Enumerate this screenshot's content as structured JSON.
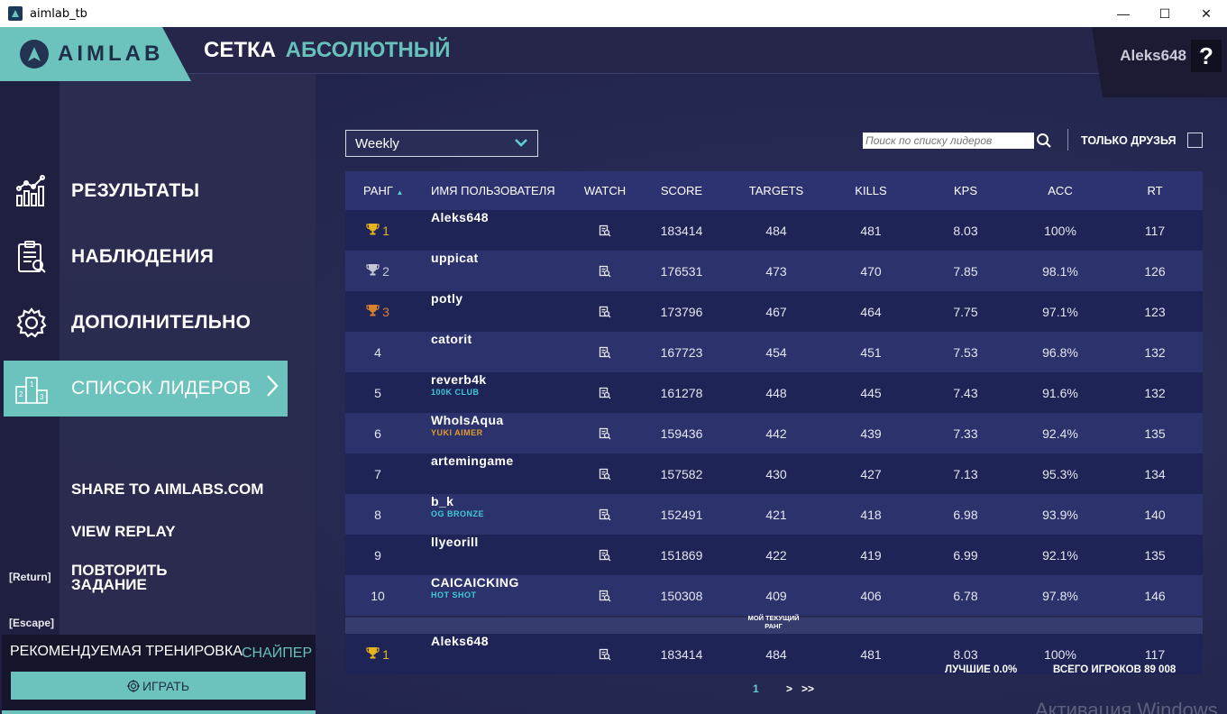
{
  "window": {
    "title": "aimlab_tb",
    "minimize": "—",
    "maximize": "☐",
    "close": "✕"
  },
  "header": {
    "logo_text": "AIMLAB",
    "title": "СЕТКА",
    "subtitle": "АБСОЛЮТНЫЙ",
    "username": "Aleks648",
    "help": "?"
  },
  "nav": [
    {
      "label": "РЕЗУЛЬТАТЫ",
      "icon": "chart-icon"
    },
    {
      "label": "НАБЛЮДЕНИЯ",
      "icon": "clipboard-icon"
    },
    {
      "label": "ДОПОЛНИТЕЛЬНО",
      "icon": "gear-icon"
    },
    {
      "label": "СПИСОК ЛИДЕРОВ",
      "icon": "podium-icon",
      "active": true
    }
  ],
  "actions": {
    "share": "SHARE TO AIMLABS.COM",
    "replay": "VIEW REPLAY",
    "repeat_line1": "ПОВТОРИТЬ",
    "repeat_line2": "ЗАДАНИЕ",
    "return_key": "[Return]",
    "escape_key": "[Escape]"
  },
  "recommended": {
    "title": "РЕКОМЕНДУЕМАЯ ТРЕНИРОВКА",
    "type": "СНАЙПЕР",
    "play": "ИГРАТЬ"
  },
  "filters": {
    "period": "Weekly",
    "search_placeholder": "Поиск по списку лидеров",
    "friends_only": "ТОЛЬКО ДРУЗЬЯ"
  },
  "table": {
    "headers": {
      "rank": "РАНГ",
      "user": "ИМЯ ПОЛЬЗОВАТЕЛЯ",
      "watch": "WATCH",
      "score": "SCORE",
      "targets": "TARGETS",
      "kills": "KILLS",
      "kps": "KPS",
      "acc": "ACC",
      "rt": "RT"
    },
    "rows": [
      {
        "rank": "1",
        "trophy": "gold",
        "user": "Aleks648",
        "tag": "",
        "score": "183414",
        "targets": "484",
        "kills": "481",
        "kps": "8.03",
        "acc": "100%",
        "rt": "117"
      },
      {
        "rank": "2",
        "trophy": "silver",
        "user": "uppicat",
        "tag": "",
        "score": "176531",
        "targets": "473",
        "kills": "470",
        "kps": "7.85",
        "acc": "98.1%",
        "rt": "126"
      },
      {
        "rank": "3",
        "trophy": "bronze",
        "user": "potly",
        "tag": "",
        "score": "173796",
        "targets": "467",
        "kills": "464",
        "kps": "7.75",
        "acc": "97.1%",
        "rt": "123"
      },
      {
        "rank": "4",
        "trophy": "",
        "user": "catorit",
        "tag": "",
        "score": "167723",
        "targets": "454",
        "kills": "451",
        "kps": "7.53",
        "acc": "96.8%",
        "rt": "132"
      },
      {
        "rank": "5",
        "trophy": "",
        "user": "reverb4k",
        "tag": "100K CLUB",
        "tag_color": "#3fc9d9",
        "score": "161278",
        "targets": "448",
        "kills": "445",
        "kps": "7.43",
        "acc": "91.6%",
        "rt": "132"
      },
      {
        "rank": "6",
        "trophy": "",
        "user": "WhoIsAqua",
        "tag": "YUKI AIMER",
        "tag_color": "#e39a2c",
        "score": "159436",
        "targets": "442",
        "kills": "439",
        "kps": "7.33",
        "acc": "92.4%",
        "rt": "135"
      },
      {
        "rank": "7",
        "trophy": "",
        "user": "artemingame",
        "tag": "",
        "score": "157582",
        "targets": "430",
        "kills": "427",
        "kps": "7.13",
        "acc": "95.3%",
        "rt": "134"
      },
      {
        "rank": "8",
        "trophy": "",
        "user": "b_k",
        "tag": "OG BRONZE",
        "tag_color": "#3fc9d9",
        "score": "152491",
        "targets": "421",
        "kills": "418",
        "kps": "6.98",
        "acc": "93.9%",
        "rt": "140"
      },
      {
        "rank": "9",
        "trophy": "",
        "user": "llyeorill",
        "tag": "",
        "score": "151869",
        "targets": "422",
        "kills": "419",
        "kps": "6.99",
        "acc": "92.1%",
        "rt": "135"
      },
      {
        "rank": "10",
        "trophy": "",
        "user": "CAICAICKING",
        "tag": "HOT SHOT",
        "tag_color": "#3fc9d9",
        "score": "150308",
        "targets": "409",
        "kills": "406",
        "kps": "6.78",
        "acc": "97.8%",
        "rt": "146"
      }
    ],
    "my_rank_label_1": "МОЙ ТЕКУЩИЙ",
    "my_rank_label_2": "РАНГ",
    "my_row": {
      "rank": "1",
      "trophy": "gold",
      "user": "Aleks648",
      "tag": "",
      "score": "183414",
      "targets": "484",
      "kills": "481",
      "kps": "8.03",
      "acc": "100%",
      "rt": "117"
    }
  },
  "footer": {
    "best": "ЛУЧШИЕ 0.0%",
    "total": "ВСЕГО ИГРОКОВ 89 008",
    "page": "1",
    "next": ">",
    "last": ">>"
  },
  "watermark": "Активация Windows",
  "colors": {
    "accent": "#6cc2bc",
    "gold": "#e8b21e",
    "silver": "#c5c8d4",
    "bronze": "#d9822e"
  }
}
